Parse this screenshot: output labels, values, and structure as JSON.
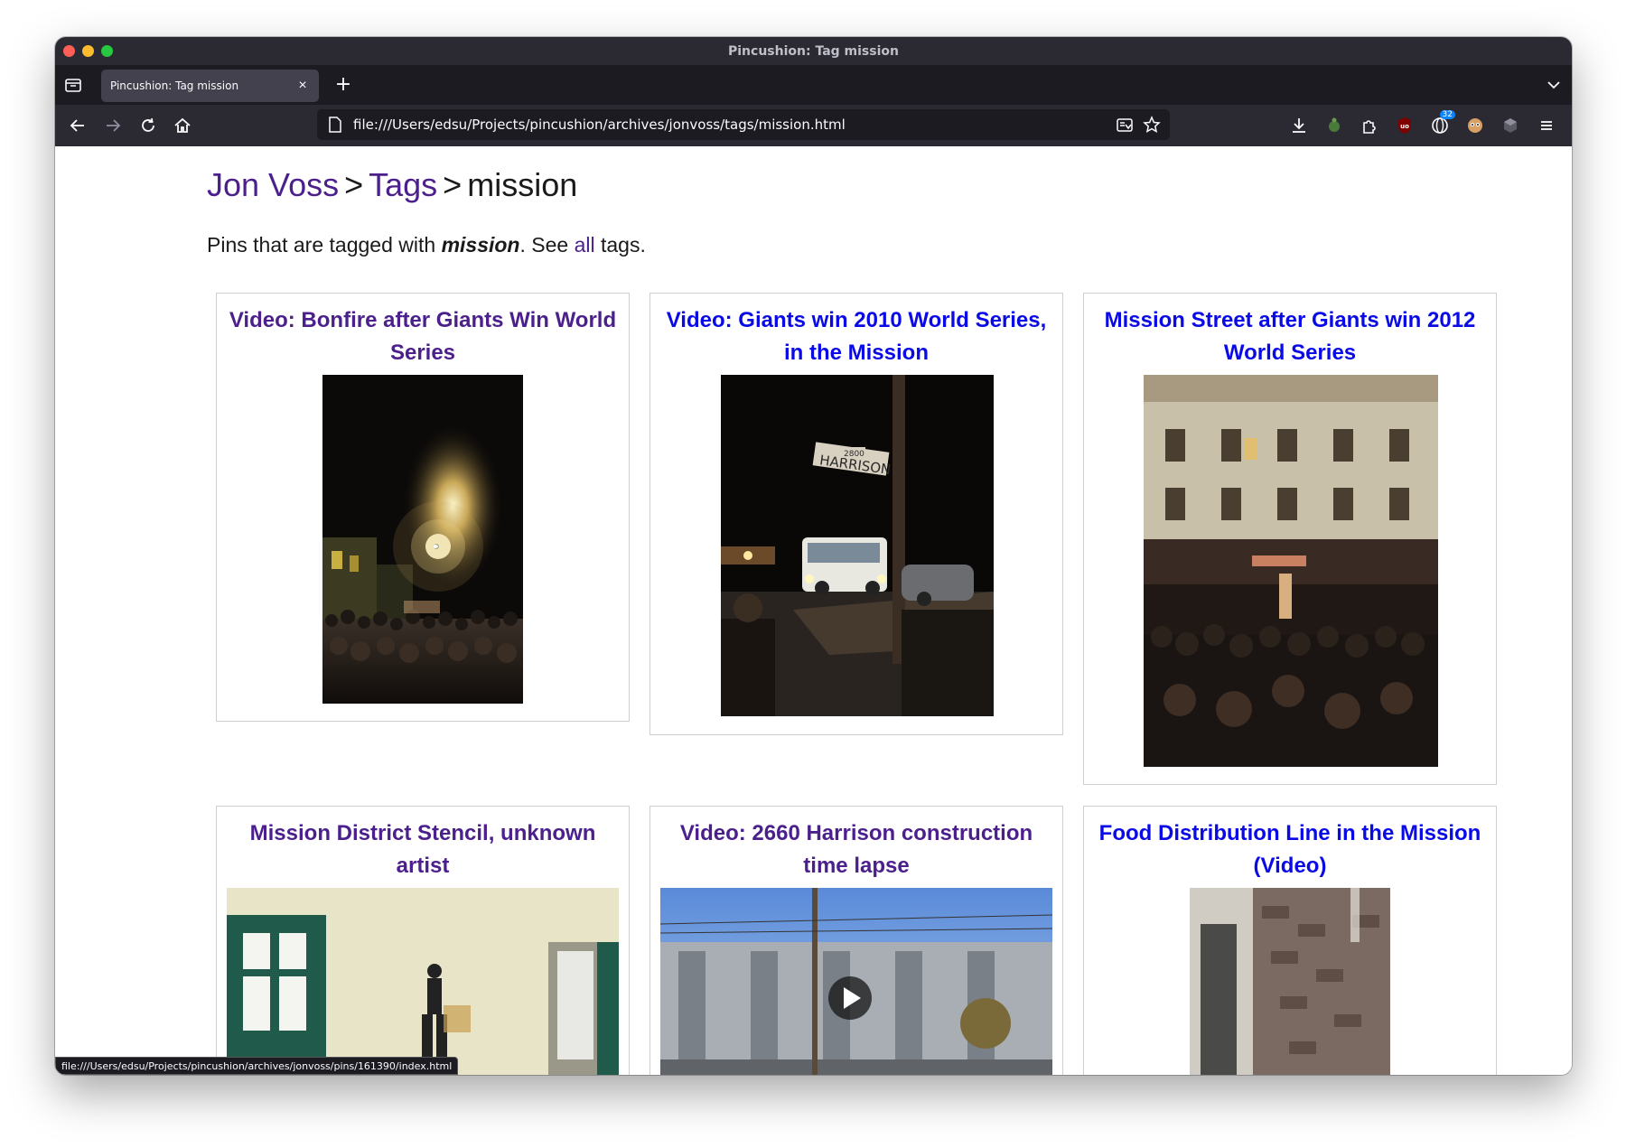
{
  "window": {
    "title": "Pincushion: Tag mission"
  },
  "tab": {
    "title": "Pincushion: Tag mission"
  },
  "navigation": {
    "url": "file:///Users/edsu/Projects/pincushion/archives/jonvoss/tags/mission.html",
    "extension_badge": "32"
  },
  "breadcrumb": {
    "user": "Jon Voss",
    "sep1": ">",
    "tags": "Tags",
    "sep2": ">",
    "current": "mission"
  },
  "intro": {
    "prefix": "Pins that are tagged with ",
    "tag": "mission",
    "middle": ". See ",
    "link": "all",
    "suffix": " tags."
  },
  "pins": [
    {
      "title": "Video: Bonfire after Giants Win World Series",
      "visited": true
    },
    {
      "title": "Video: Giants win 2010 World Series, in the Mission",
      "visited": false
    },
    {
      "title": "Mission Street after Giants win 2012 World Series",
      "visited": false
    },
    {
      "title": "Mission District Stencil, unknown artist",
      "visited": true
    },
    {
      "title": "Video: 2660 Harrison construction time lapse",
      "visited": true
    },
    {
      "title": "Food Distribution Line in the Mission (Video)",
      "visited": false
    }
  ],
  "status": {
    "link_hover": "file:///Users/edsu/Projects/pincushion/archives/jonvoss/pins/161390/index.html"
  }
}
